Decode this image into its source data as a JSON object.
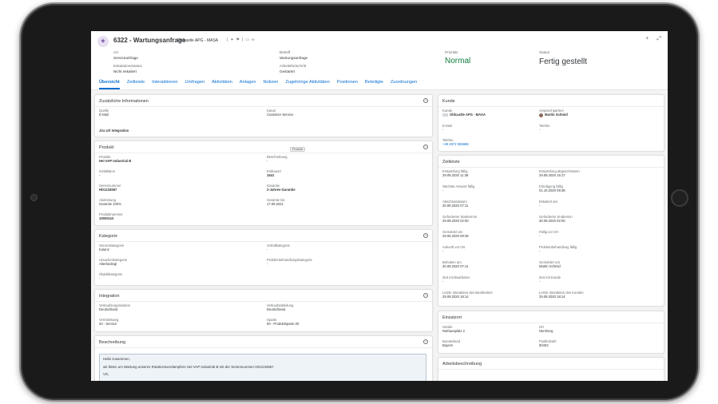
{
  "header": {
    "icon": "service-request-icon",
    "title": "6322 - Wartungsanfrage",
    "subtitle": "Oldcastle APG - MASA",
    "fields_left": [
      {
        "label": "Art",
        "value": "Serviceanfrage"
      },
      {
        "label": "Eskalationsstatus",
        "value": "Nicht eskaliert"
      }
    ],
    "fields_mid": [
      {
        "label": "Betreff",
        "value": "Wartungsanfrage"
      },
      {
        "label": "Arbeitsfortschritt",
        "value": "Gestartet"
      }
    ],
    "priority": {
      "label": "Priorität",
      "value": "Normal"
    },
    "status": {
      "label": "Status",
      "value": "Fertig gestellt"
    },
    "priority_color": "#107e3e"
  },
  "tabs": [
    "Übersicht",
    "Zeitleiste",
    "Interaktionen",
    "Umfragen",
    "Aktivitäten",
    "Anlagen",
    "Notizen",
    "Zugehörige Aktivitäten",
    "Positionen",
    "Beteiligte",
    "Zuordnungen"
  ],
  "zusatz": {
    "title": "Zusätzliche Informationen",
    "quelle_label": "Quelle",
    "quelle_value": "E-Mail",
    "kanal_label": "Kanal",
    "kanal_value": "Customer Service",
    "extra": "Jira Url Integration"
  },
  "produkt": {
    "title": "Produkt",
    "badge": "Produkt",
    "fields": [
      {
        "label": "Produkt",
        "value": "Hei-VAP Industrial B"
      },
      {
        "label": "Beschreibung",
        "value": "-"
      },
      {
        "label": "Installation",
        "value": "-"
      },
      {
        "label": "Einbauort",
        "value": "1541"
      },
      {
        "label": "Seriennummer",
        "value": "HD1234567"
      },
      {
        "label": "Garantie",
        "value": "2-Jahres-Garantie"
      },
      {
        "label": "Abdeckung",
        "value": "Garantie 100%"
      },
      {
        "label": "Garantie bis",
        "value": "17.09.2021"
      },
      {
        "label": "Produktnummer",
        "value": "10000110"
      }
    ]
  },
  "kategorie": {
    "title": "Kategorie",
    "fields": [
      {
        "label": "Servicekategorie",
        "value": "Kulanz"
      },
      {
        "label": "Vorfallkategorie",
        "value": "-"
      },
      {
        "label": "Ursachenkategorie",
        "value": "Alterbedingt"
      },
      {
        "label": "Problembehandlungskategorie",
        "value": "-"
      },
      {
        "label": "Objektkategorie",
        "value": "-"
      }
    ]
  },
  "integration": {
    "title": "Integration",
    "fields": [
      {
        "label": "Verkaufsorganisation",
        "value": "Deutschland"
      },
      {
        "label": "Verkaufsabteilung",
        "value": "Deutschland"
      },
      {
        "label": "Vertriebsweg",
        "value": "20 - Service"
      },
      {
        "label": "Sparte",
        "value": "00 - Produktsparte 00"
      }
    ]
  },
  "beschreibung": {
    "title": "Beschreibung",
    "lines": [
      "Hallo zusammen,",
      "wir bitten um Wartung unseres Rotationsverdampfers Hei-VAP Industrial B mit der Seriennummer HD1234567",
      "VG,"
    ]
  },
  "kunde": {
    "title": "Kunde",
    "kunde_label": "Kunde",
    "kunde_value": "Oldcastle APG - MASA",
    "ansprech_label": "Ansprechpartner",
    "ansprech_value": "Martin Schmid",
    "email_label": "E-Mail",
    "email_value": "-",
    "telefon_label": "Telefon",
    "telefon_value": "-",
    "telefon2_label": "Telefon",
    "telefon2_value": "+49 2572 555666"
  },
  "zeitleiste": {
    "title": "Zeitleiste",
    "fields": [
      {
        "label": "Erstprüfung fällig",
        "value": "29.09.2020 11:38"
      },
      {
        "label": "Erstprüfung abgeschlossen",
        "value": "29.09.2020 15:17"
      },
      {
        "label": "Nächste Antwort fällig",
        "value": "-"
      },
      {
        "label": "Erledigung fällig",
        "value": "01.10.2020 09:38"
      },
      {
        "label": "Abschlussdatum",
        "value": "30.09.2020 07:11"
      },
      {
        "label": "Eskaliert am",
        "value": "-"
      },
      {
        "label": "Geforderter Starttermin",
        "value": "29.09.2020 02:00"
      },
      {
        "label": "Geforderter Endtermin",
        "value": "30.09.2020 02:00"
      },
      {
        "label": "Gemeldet am",
        "value": "29.09.2020 09:38"
      },
      {
        "label": "Fällig vor Ort",
        "value": "-"
      },
      {
        "label": "Ankunft vor Ort",
        "value": "-"
      },
      {
        "label": "Problembehandlung fällig",
        "value": "-"
      },
      {
        "label": "Behoben am",
        "value": "30.09.2020 07:11"
      },
      {
        "label": "Gemeldet von",
        "value": "Martin Schmid"
      },
      {
        "label": "Zeit mit Bearbeiter",
        "value": "-"
      },
      {
        "label": "Zeit mit Kunde",
        "value": "-"
      },
      {
        "label": "Letzte Interaktion des Bearbeiters",
        "value": "29.09.2020 18:14"
      },
      {
        "label": "Letzte Interaktion des Kunden",
        "value": "29.09.2020 18:14"
      }
    ]
  },
  "einsatzort": {
    "title": "Einsatzort",
    "fields": [
      {
        "label": "Straße",
        "value": "Rathausplatz 2"
      },
      {
        "label": "Ort",
        "value": "Nürnberg"
      },
      {
        "label": "Bundesland",
        "value": "Bayern"
      },
      {
        "label": "Postleitzahl",
        "value": "90402"
      }
    ]
  },
  "arbeitsbeschreibung": {
    "title": "Arbeitsbeschreibung"
  },
  "accent": "#0a6ed1"
}
